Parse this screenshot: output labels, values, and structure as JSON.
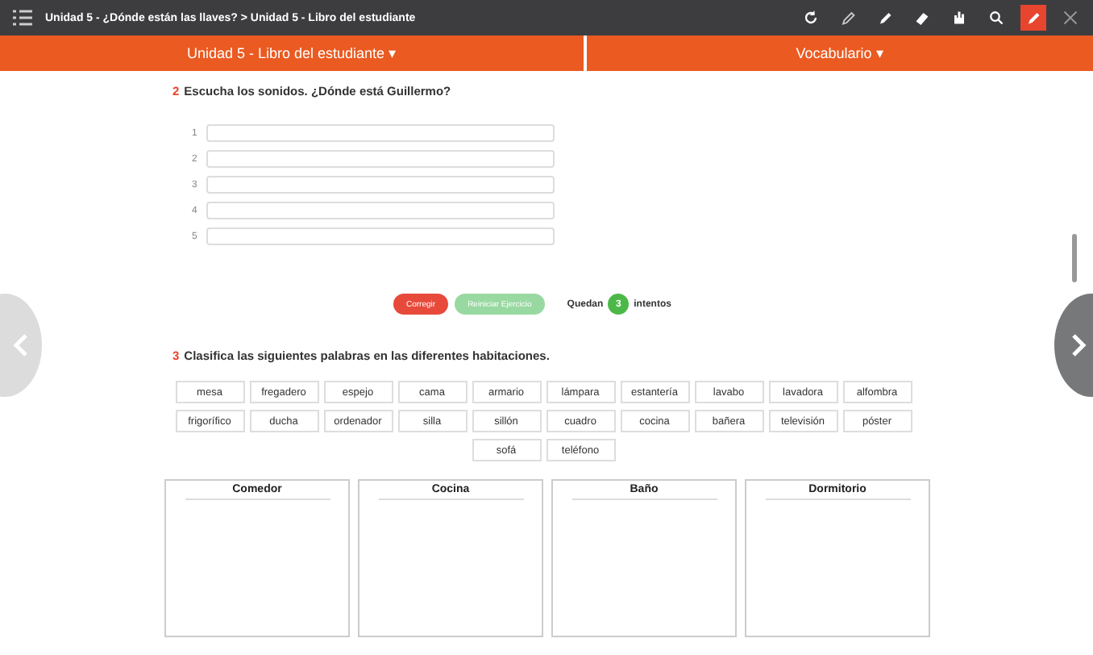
{
  "top_bar": {
    "breadcrumb": "Unidad 5 - ¿Dónde están las llaves? > Unidad 5 - Libro del estudiante",
    "tools": [
      {
        "kind": "refresh",
        "selected": false
      },
      {
        "kind": "pencil",
        "selected": false
      },
      {
        "kind": "marker",
        "selected": false
      },
      {
        "kind": "eraser",
        "selected": false
      },
      {
        "kind": "hand",
        "selected": false
      },
      {
        "kind": "search",
        "selected": false
      },
      {
        "kind": "pen",
        "selected": true
      },
      {
        "kind": "close",
        "selected": false
      }
    ]
  },
  "nav_tabs": [
    {
      "label": "Unidad 5 - Libro del estudiante",
      "caret": "▾"
    },
    {
      "label": "Vocabulario",
      "caret": "▾"
    }
  ],
  "exercise_2": {
    "number": "2",
    "title": "Escucha los sonidos. ¿Dónde está Guillermo?",
    "answers": [
      {
        "label": "1"
      },
      {
        "label": "2"
      },
      {
        "label": "3"
      },
      {
        "label": "4"
      },
      {
        "label": "5"
      }
    ],
    "buttons": [
      {
        "label": "Corregir",
        "kind": "check",
        "disabled": false
      },
      {
        "label": "Reiniciar Ejercicio",
        "kind": "reset",
        "disabled": true
      }
    ],
    "attempts": {
      "prefix": "Quedan",
      "count": "3",
      "suffix": "intentos"
    }
  },
  "exercise_3": {
    "number": "3",
    "title": "Clasifica las siguientes palabras en las diferentes habitaciones.",
    "words": [
      "mesa",
      "fregadero",
      "espejo",
      "cama",
      "armario",
      "lámpara",
      "estantería",
      "lavabo",
      "lavadora",
      "alfombra",
      "frigorífico",
      "ducha",
      "ordenador",
      "silla",
      "sillón",
      "cuadro",
      "cocina",
      "bañera",
      "televisión",
      "póster",
      "sofá",
      "teléfono"
    ],
    "rooms": [
      "Comedor",
      "Cocina",
      "Baño",
      "Dormitorio"
    ]
  }
}
